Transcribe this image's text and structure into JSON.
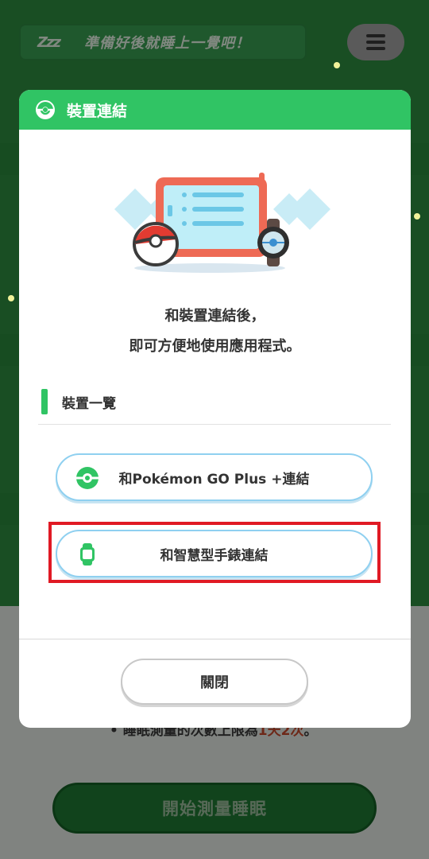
{
  "background": {
    "banner_text": "準備好後就睡上一覺吧！",
    "banner_icon": "zzz-icon",
    "zzz_glyph": "Zzz",
    "menu_icon": "hamburger-menu-icon",
    "note_prefix": "• 睡眠測量的次數上限為",
    "note_highlight": "1天2次",
    "note_suffix": "。",
    "start_button": "開始測量睡眠"
  },
  "modal": {
    "title": "裝置連結",
    "title_icon": "pokeball-icon",
    "description_line1": "和裝置連結後，",
    "description_line2": "即可方便地使用應用程式。",
    "section_label": "裝置一覽",
    "devices": [
      {
        "label": "和Pokémon GO Plus +連結",
        "icon": "go-plus-icon"
      },
      {
        "label": "和智慧型手錶連結",
        "icon": "smartwatch-icon"
      }
    ],
    "close_label": "關閉"
  },
  "colors": {
    "header_green": "#30c464",
    "button_border": "#8fd0f0",
    "highlight_red": "#e01a24",
    "game_green": "#2f8f41"
  }
}
